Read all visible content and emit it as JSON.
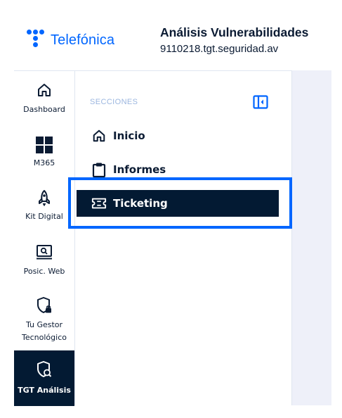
{
  "brand": {
    "name": "Telefónica",
    "color": "#0066ff"
  },
  "header": {
    "title": "Análisis Vulnerabilidades",
    "subtitle": "9110218.tgt.seguridad.av"
  },
  "rail": {
    "items": [
      {
        "label": "Dashboard",
        "icon": "home-icon"
      },
      {
        "label": "M365",
        "icon": "windows-icon"
      },
      {
        "label": "Kit Digital",
        "icon": "rocket-icon"
      },
      {
        "label": "Posic. Web",
        "icon": "monitor-search-icon"
      },
      {
        "label": "Tu Gestor Tecnológico",
        "label_line1": "Tu Gestor",
        "label_line2": "Tecnológico",
        "icon": "shield-lock-icon"
      },
      {
        "label": "TGT Análisis",
        "icon": "shield-search-icon",
        "active": true
      }
    ]
  },
  "panel": {
    "section_label": "SECCIONES",
    "collapse_icon": "sidebar-collapse-icon",
    "items": [
      {
        "label": "Inicio",
        "icon": "home-icon"
      },
      {
        "label": "Informes",
        "icon": "clipboard-icon"
      },
      {
        "label": "Ticketing",
        "icon": "ticket-icon",
        "active": true
      }
    ]
  },
  "colors": {
    "navy": "#031a33",
    "accent": "#0066ff",
    "content_bg": "#eef0f9"
  }
}
